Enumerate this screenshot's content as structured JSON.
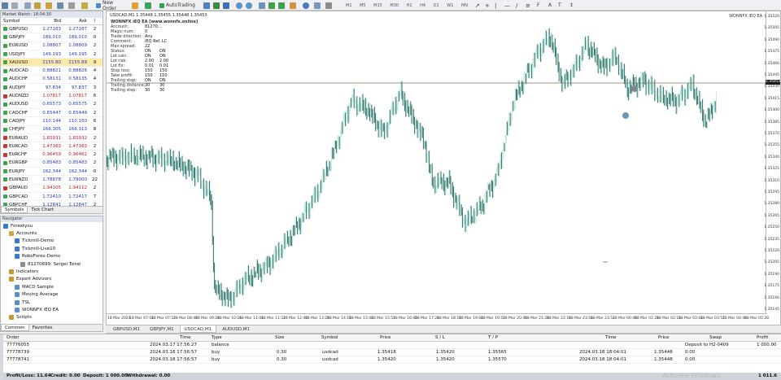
{
  "toolbar": {
    "new_order_label": "New Order",
    "auto_trading_label": "AutoTrading",
    "timeframes": [
      "M1",
      "M5",
      "M15",
      "M30",
      "H1",
      "H4",
      "D1",
      "W1",
      "MN"
    ]
  },
  "market_watch": {
    "title": "Market Watch: 18:04:30",
    "columns": [
      "Symbol",
      "Bid",
      "Ask",
      "!"
    ],
    "rows": [
      {
        "symbol": "GBPUSD",
        "bid": "1.27283",
        "ask": "1.27287",
        "spread": "2",
        "dir": "up"
      },
      {
        "symbol": "GBPJPY",
        "bid": "189.010",
        "ask": "189.010",
        "spread": "0",
        "dir": "up"
      },
      {
        "symbol": "EURUSD",
        "bid": "1.08807",
        "ask": "1.08809",
        "spread": "2",
        "dir": "up"
      },
      {
        "symbol": "USDJPY",
        "bid": "149.193",
        "ask": "149.195",
        "spread": "2",
        "dir": "up"
      },
      {
        "symbol": "XAUUSD",
        "bid": "2155.80",
        "ask": "2155.89",
        "spread": "9",
        "dir": "up",
        "selected": true
      },
      {
        "symbol": "AUDCAD",
        "bid": "0.88821",
        "ask": "0.88826",
        "spread": "4",
        "dir": "up"
      },
      {
        "symbol": "AUDCHF",
        "bid": "0.58131",
        "ask": "0.58135",
        "spread": "4",
        "dir": "up"
      },
      {
        "symbol": "AUDJPY",
        "bid": "97.834",
        "ask": "97.837",
        "spread": "3",
        "dir": "up"
      },
      {
        "symbol": "AUDNZD",
        "bid": "1.07817",
        "ask": "1.07817",
        "spread": "6",
        "dir": "down"
      },
      {
        "symbol": "AUDUSD",
        "bid": "0.65573",
        "ask": "0.65575",
        "spread": "2",
        "dir": "up"
      },
      {
        "symbol": "CADCHF",
        "bid": "0.65447",
        "ask": "0.65449",
        "spread": "2",
        "dir": "up"
      },
      {
        "symbol": "CADJPY",
        "bid": "110.144",
        "ask": "110.150",
        "spread": "6",
        "dir": "up"
      },
      {
        "symbol": "CHFJPY",
        "bid": "168.305",
        "ask": "168.313",
        "spread": "8",
        "dir": "up"
      },
      {
        "symbol": "EURAUD",
        "bid": "1.65931",
        "ask": "1.65932",
        "spread": "2",
        "dir": "down"
      },
      {
        "symbol": "EURCAD",
        "bid": "1.47383",
        "ask": "1.47383",
        "spread": "2",
        "dir": "down"
      },
      {
        "symbol": "EURCHF",
        "bid": "0.96459",
        "ask": "0.96461",
        "spread": "2",
        "dir": "down"
      },
      {
        "symbol": "EURGBP",
        "bid": "0.85483",
        "ask": "0.85483",
        "spread": "2",
        "dir": "up"
      },
      {
        "symbol": "EURJPY",
        "bid": "162.344",
        "ask": "162.344",
        "spread": "0",
        "dir": "up"
      },
      {
        "symbol": "EURNZD",
        "bid": "1.78878",
        "ask": "1.79000",
        "spread": "22",
        "dir": "up"
      },
      {
        "symbol": "GBPAUD",
        "bid": "1.94105",
        "ask": "1.94112",
        "spread": "2",
        "dir": "down"
      },
      {
        "symbol": "GBPCAD",
        "bid": "1.72410",
        "ask": "1.72417",
        "spread": "7",
        "dir": "up"
      },
      {
        "symbol": "GBPCHF",
        "bid": "1.12841",
        "ask": "1.12847",
        "spread": "2",
        "dir": "up"
      }
    ],
    "tabs": [
      "Symbols",
      "Tick Chart"
    ]
  },
  "navigator": {
    "title": "Navigator",
    "items": [
      {
        "label": "Forextyou",
        "level": 0
      },
      {
        "label": "Accounts",
        "level": 1
      },
      {
        "label": "Tickmill-Demo",
        "level": 2
      },
      {
        "label": "Tickmill-Live10",
        "level": 2
      },
      {
        "label": "RoboForex-Demo",
        "level": 2
      },
      {
        "label": "81270699: Sergei Tsirat",
        "level": 3
      },
      {
        "label": "Indicators",
        "level": 1
      },
      {
        "label": "Expert Advisors",
        "level": 1
      },
      {
        "label": "MACD Sample",
        "level": 2
      },
      {
        "label": "Moving Average",
        "level": 2
      },
      {
        "label": "TSL",
        "level": 2
      },
      {
        "label": "WONNFX iEQ EA",
        "level": 2
      },
      {
        "label": "Scripts",
        "level": 1
      }
    ],
    "tabs": [
      "Common",
      "Favorites"
    ]
  },
  "chart": {
    "title": "USDCAD,M1  1.35448 1.35455 1.35448 1.35453",
    "ea_name": "WONNFX iEQ EA",
    "ea_tag": "WONNFX iEQ EA",
    "ea_info": [
      {
        "k": "WONNFX iEQ EA [www.wonnfx.online]",
        "v": "",
        "w": ""
      },
      {
        "k": "Account:",
        "v": "81270...",
        "w": ""
      },
      {
        "k": "Magic num:",
        "v": "0",
        "w": ""
      },
      {
        "k": "Trade direction:",
        "v": "Any",
        "w": ""
      },
      {
        "k": "Comment:",
        "v": "iEQ Ref. LC",
        "w": ""
      },
      {
        "k": "Max spread:",
        "v": "22",
        "w": ""
      },
      {
        "k": "",
        "v": "",
        "w": ""
      },
      {
        "k": "Status:",
        "v": "ON",
        "w": "ON"
      },
      {
        "k": "Lot calc:",
        "v": "ON",
        "w": "ON"
      },
      {
        "k": "Lot risk:",
        "v": "2.00",
        "w": "2.00"
      },
      {
        "k": "Lot fix:",
        "v": "0.01",
        "w": "0.01"
      },
      {
        "k": "Stop loss:",
        "v": "150",
        "w": "150"
      },
      {
        "k": "Take profit:",
        "v": "150",
        "w": "150"
      },
      {
        "k": "Trailing stop:",
        "v": "ON",
        "w": "ON"
      },
      {
        "k": "Trailing distance:",
        "v": "30",
        "w": "30"
      },
      {
        "k": "Trailing step:",
        "v": "30",
        "w": "30"
      }
    ],
    "price_labels": [
      "1.35520",
      "1.35505",
      "1.35490",
      "1.35475",
      "1.35460",
      "1.35445",
      "1.35430",
      "1.35415",
      "1.35400",
      "1.35385",
      "1.35370",
      "1.35355",
      "1.35340",
      "1.35325",
      "1.35310",
      "1.35295",
      "1.35280",
      "1.35265",
      "1.35250",
      "1.35235",
      "1.35220",
      "1.35205",
      "1.35190",
      "1.35175",
      "1.35160",
      "1.35145"
    ],
    "current_price": "1.35453",
    "time_labels": [
      "18 Mar 2024",
      "18 Mar 07:04",
      "18 Mar 07:52",
      "18 Mar 08:40",
      "18 Mar 09:28",
      "18 Mar 10:16",
      "18 Mar 11:04",
      "18 Mar 11:52",
      "18 Mar 12:40",
      "18 Mar 13:28",
      "18 Mar 14:16",
      "18 Mar 15:04",
      "18 Mar 15:52",
      "18 Mar 16:40",
      "18 Mar 17:28",
      "18 Mar 18:16",
      "18 Mar 19:04",
      "18 Mar 19:52",
      "18 Mar 20:40",
      "18 Mar 21:28",
      "18 Mar 22:16",
      "18 Mar 23:04",
      "18 Mar 23:52",
      "18 Mar 00:40",
      "18 Mar 01:28",
      "18 Mar 02:16",
      "18 Mar 03:04",
      "18 Mar 03:52",
      "18 Mar 04:40",
      "18 Mar 05:28"
    ],
    "tabs": [
      "GBPUSD,M1",
      "GBPJPY,M1",
      "USDCAD,M1",
      "AUDUSD,M1"
    ],
    "active_tab": 2,
    "colors": {
      "bull": "#bfe8e0",
      "bear": "#2e6f66",
      "line": "#7a7a5c"
    }
  },
  "terminal": {
    "columns": [
      "Order",
      "Time",
      "Type",
      "Size",
      "Symbol",
      "Price",
      "S / L",
      "T / P",
      "Time",
      "Price",
      "Swap",
      "Profit"
    ],
    "rows": [
      {
        "order": "77776055",
        "time": "2024.03.17 17:56:27",
        "type": "balance",
        "size": "",
        "symbol": "",
        "price": "",
        "sl": "",
        "tp": "",
        "ctime": "",
        "cprice": "",
        "swap": "Deposit to H2-0409",
        "profit": "1 000.00"
      },
      {
        "order": "77778739",
        "time": "2024.03.18 17:56:57",
        "type": "buy",
        "size": "0.30",
        "symbol": "usdcad",
        "price": "1.35418",
        "sl": "1.35420",
        "tp": "1.35565",
        "ctime": "2024.03.18 18:04:01",
        "cprice": "1.35448",
        "swap": "0.00",
        "profit": ""
      },
      {
        "order": "77778741",
        "time": "2024.03.18 17:56:57",
        "type": "buy",
        "size": "0.30",
        "symbol": "usdcad",
        "price": "1.35420",
        "sl": "1.35420",
        "tp": "1.35570",
        "ctime": "2024.03.18 18:04:01",
        "cprice": "1.35448",
        "swap": "0.00",
        "profit": ""
      }
    ],
    "status": {
      "profit_loss": "Profit/Loss: 11.64",
      "credit": "Credit: 0.00",
      "deposit": "Deposit: 1 000.00",
      "withdrawal": "Withdrawal: 0.00",
      "total": "1 011.6"
    },
    "watermark": "Activate Windows"
  }
}
